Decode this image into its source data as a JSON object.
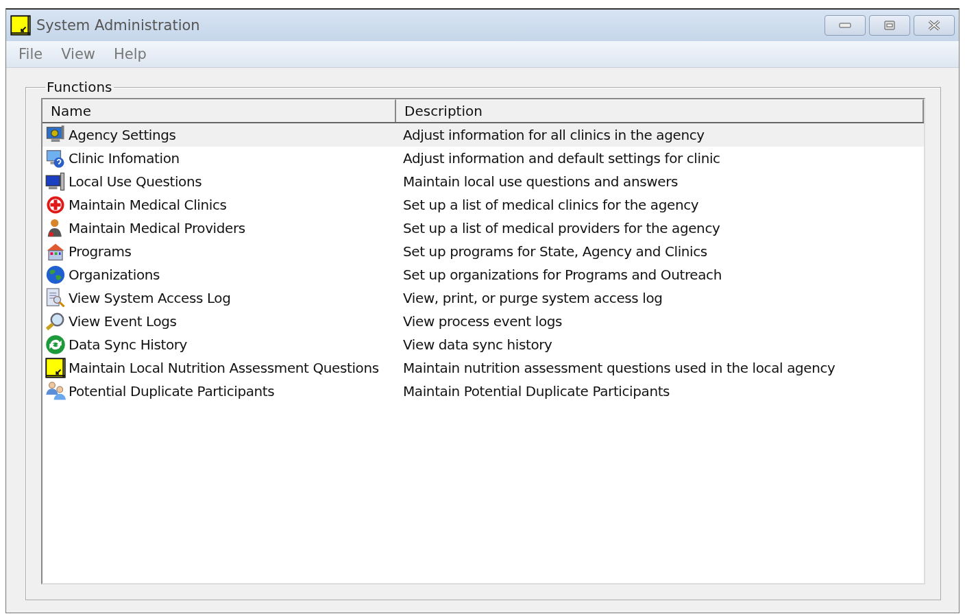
{
  "window": {
    "title": "System Administration"
  },
  "menu": [
    "File",
    "View",
    "Help"
  ],
  "group": {
    "title": "Functions"
  },
  "table": {
    "columns": [
      "Name",
      "Description"
    ],
    "rows": [
      {
        "kind": "settings",
        "name": "Agency Settings",
        "description": "Adjust information for all clinics in the agency",
        "selected": true
      },
      {
        "kind": "info",
        "name": "Clinic Infomation",
        "description": "Adjust information and default settings for clinic",
        "selected": false
      },
      {
        "kind": "monitor",
        "name": "Local Use Questions",
        "description": "Maintain local use questions and answers",
        "selected": false
      },
      {
        "kind": "cross",
        "name": "Maintain Medical Clinics",
        "description": "Set up a list of medical clinics for the agency",
        "selected": false
      },
      {
        "kind": "person",
        "name": "Maintain Medical Providers",
        "description": "Set up a list of medical providers for the agency",
        "selected": false
      },
      {
        "kind": "building",
        "name": "Programs",
        "description": "Set up programs for State, Agency and Clinics",
        "selected": false
      },
      {
        "kind": "globe",
        "name": "Organizations",
        "description": "Set up organizations for Programs and Outreach",
        "selected": false
      },
      {
        "kind": "document",
        "name": "View System Access Log",
        "description": "View, print, or purge system access log",
        "selected": false
      },
      {
        "kind": "magnifier",
        "name": "View Event Logs",
        "description": "View process event logs",
        "selected": false
      },
      {
        "kind": "sync",
        "name": "Data Sync History",
        "description": "View data sync history",
        "selected": false
      },
      {
        "kind": "note",
        "name": "Maintain Local Nutrition Assessment Questions",
        "description": "Maintain nutrition assessment questions used in the local agency",
        "selected": false
      },
      {
        "kind": "people",
        "name": "Potential Duplicate Participants",
        "description": "Maintain Potential Duplicate Participants",
        "selected": false
      }
    ]
  }
}
